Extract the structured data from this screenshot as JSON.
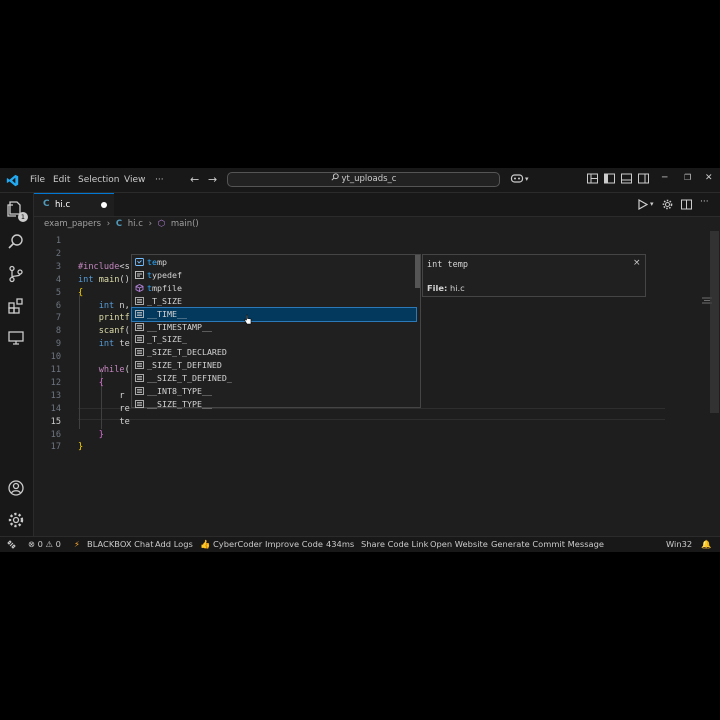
{
  "menu": [
    "File",
    "Edit",
    "Selection",
    "View",
    "···"
  ],
  "command_center": {
    "label": "yt_uploads_c",
    "icon": "search-icon"
  },
  "tab": {
    "lang": "C",
    "filename": "hi.c",
    "modified": true
  },
  "breadcrumb": {
    "folder": "exam_papers",
    "sep1": "›",
    "file_lang": "C",
    "file": "hi.c",
    "sep2": "›",
    "symbol": "main()"
  },
  "activity_badge": "1",
  "line_numbers": [
    "1",
    "2",
    "3",
    "4",
    "5",
    "6",
    "7",
    "8",
    "9",
    "10",
    "11",
    "12",
    "13",
    "14",
    "15",
    "16",
    "17"
  ],
  "code_lines": [
    "",
    "",
    "#include<s",
    "int main()",
    "{",
    "    int n,",
    "    printf",
    "    scanf(",
    "    int te",
    "",
    "    while(",
    "    {",
    "        r",
    "        re",
    "        te",
    "    }",
    "}"
  ],
  "suggestions": [
    {
      "label": "temp",
      "kind": "variable",
      "icon": "variable-icon"
    },
    {
      "label": "typedef",
      "kind": "snippet",
      "icon": "snippet-icon"
    },
    {
      "label": "tmpfile",
      "kind": "function",
      "icon": "cube-icon"
    },
    {
      "label": "_T_SIZE",
      "kind": "text",
      "icon": "text-icon"
    },
    {
      "label": "__TIME__",
      "kind": "text",
      "icon": "text-icon"
    },
    {
      "label": "__TIMESTAMP__",
      "kind": "text",
      "icon": "text-icon"
    },
    {
      "label": "_T_SIZE_",
      "kind": "text",
      "icon": "text-icon"
    },
    {
      "label": "_SIZE_T_DECLARED",
      "kind": "text",
      "icon": "text-icon"
    },
    {
      "label": "_SIZE_T_DEFINED",
      "kind": "text",
      "icon": "text-icon"
    },
    {
      "label": "__SIZE_T_DEFINED_",
      "kind": "text",
      "icon": "text-icon"
    },
    {
      "label": "__INT8_TYPE__",
      "kind": "text",
      "icon": "text-icon"
    },
    {
      "label": "__SIZE_TYPE__",
      "kind": "text",
      "icon": "text-icon"
    }
  ],
  "suggestion_detail": {
    "signature": "int temp",
    "close": "×",
    "file_label": "File:",
    "file_value": "hi.c"
  },
  "statusbar": {
    "remote_icon": "remote-icon",
    "problems": "⊗ 0 ⚠ 0",
    "blackbox": "BLACKBOX Chat",
    "add_logs": "Add Logs",
    "cybercoder": "CyberCoder",
    "improve_code": "Improve Code",
    "time": "434ms",
    "share_code": "Share Code Link",
    "open_website": "Open Website",
    "commit_message": "Generate Commit Message",
    "platform": "Win32"
  },
  "colors": {
    "accent": "#0078d4",
    "background": "#1e1e1e",
    "chrome": "#181818",
    "match_highlight": "#2aaaff"
  }
}
